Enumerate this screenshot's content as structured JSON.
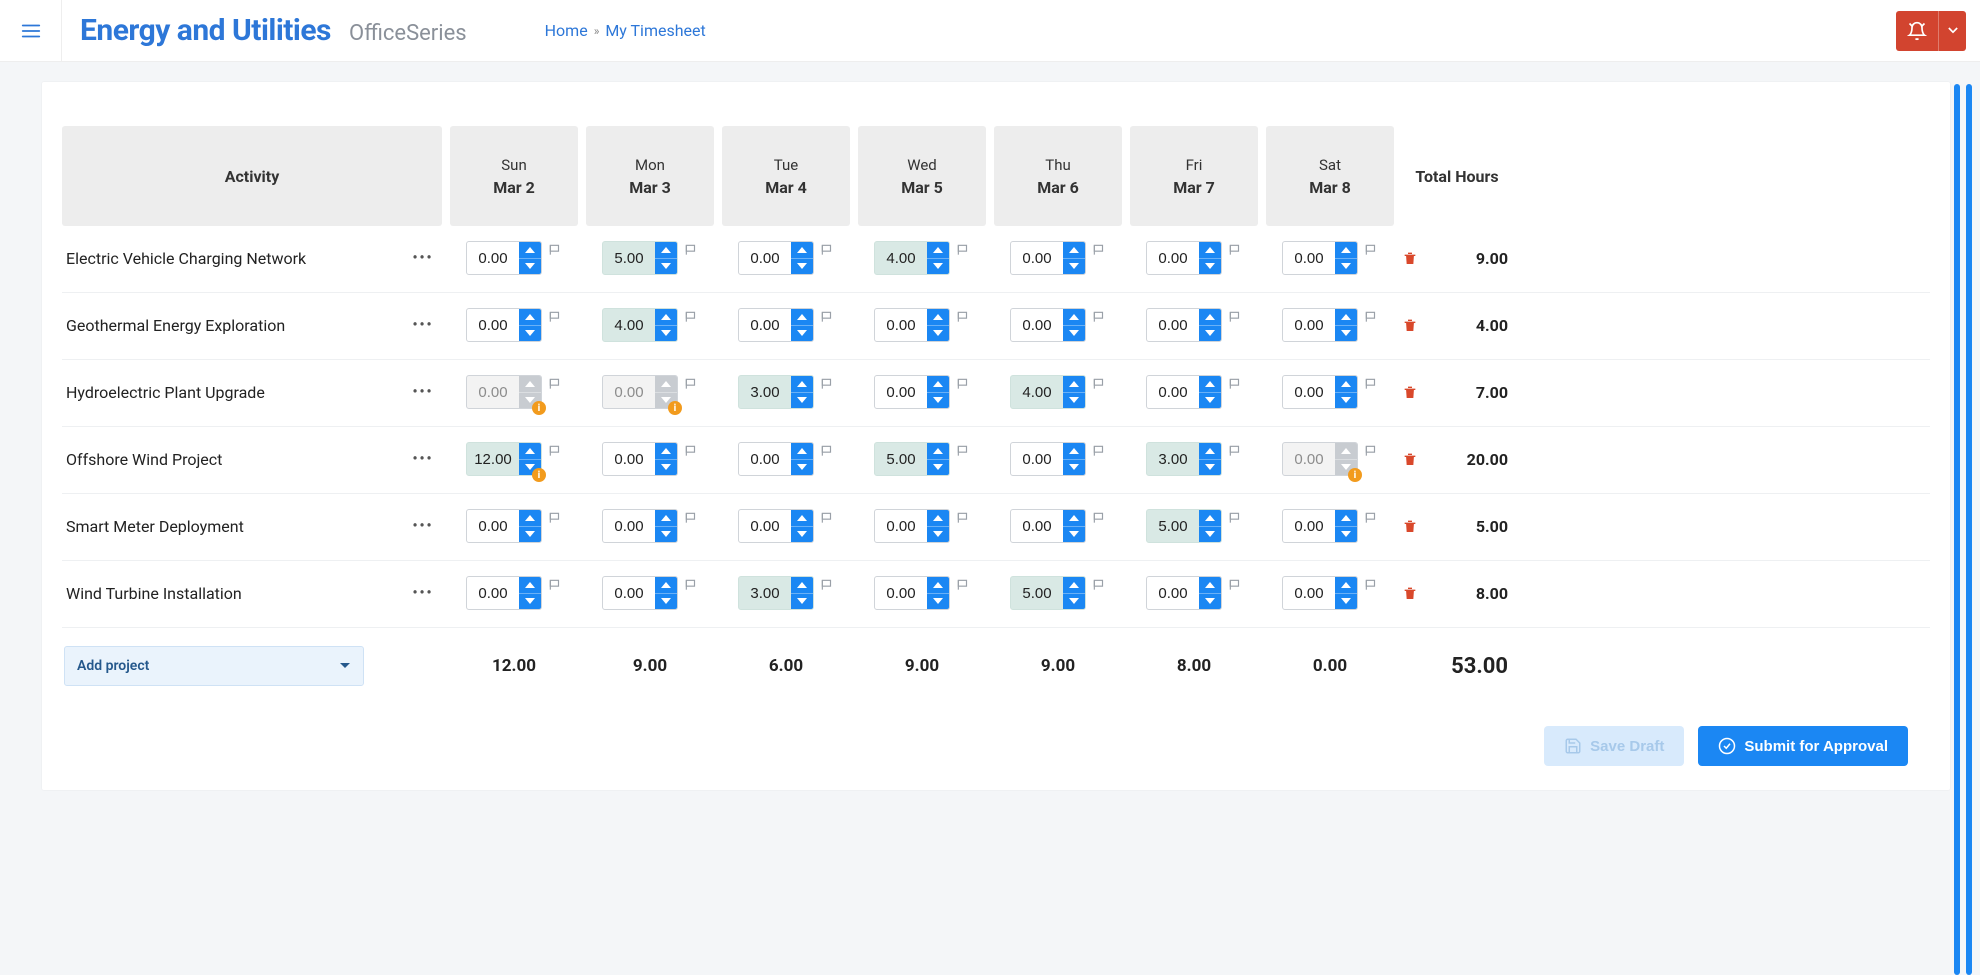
{
  "header": {
    "brand_title": "Energy and Utilities",
    "brand_sub": "OfficeSeries",
    "crumb_home": "Home",
    "crumb_page": "My Timesheet"
  },
  "columns": {
    "activity": "Activity",
    "total": "Total Hours",
    "days": [
      {
        "dow": "Sun",
        "date": "Mar 2"
      },
      {
        "dow": "Mon",
        "date": "Mar 3"
      },
      {
        "dow": "Tue",
        "date": "Mar 4"
      },
      {
        "dow": "Wed",
        "date": "Mar 5"
      },
      {
        "dow": "Thu",
        "date": "Mar 6"
      },
      {
        "dow": "Fri",
        "date": "Mar 7"
      },
      {
        "dow": "Sat",
        "date": "Mar 8"
      }
    ]
  },
  "rows": [
    {
      "name": "Electric Vehicle Charging Network",
      "cells": [
        {
          "v": "0.00"
        },
        {
          "v": "5.00",
          "hi": true
        },
        {
          "v": "0.00"
        },
        {
          "v": "4.00",
          "hi": true
        },
        {
          "v": "0.00"
        },
        {
          "v": "0.00"
        },
        {
          "v": "0.00"
        }
      ],
      "total": "9.00"
    },
    {
      "name": "Geothermal Energy Exploration",
      "cells": [
        {
          "v": "0.00"
        },
        {
          "v": "4.00",
          "hi": true
        },
        {
          "v": "0.00"
        },
        {
          "v": "0.00"
        },
        {
          "v": "0.00"
        },
        {
          "v": "0.00"
        },
        {
          "v": "0.00"
        }
      ],
      "total": "4.00"
    },
    {
      "name": "Hydroelectric Plant Upgrade",
      "cells": [
        {
          "v": "0.00",
          "dis": true,
          "warn": true
        },
        {
          "v": "0.00",
          "dis": true,
          "warn": true
        },
        {
          "v": "3.00",
          "hi": true
        },
        {
          "v": "0.00"
        },
        {
          "v": "4.00",
          "hi": true
        },
        {
          "v": "0.00"
        },
        {
          "v": "0.00"
        }
      ],
      "total": "7.00"
    },
    {
      "name": "Offshore Wind Project",
      "cells": [
        {
          "v": "12.00",
          "hi": true,
          "warn": true
        },
        {
          "v": "0.00"
        },
        {
          "v": "0.00"
        },
        {
          "v": "5.00",
          "hi": true
        },
        {
          "v": "0.00"
        },
        {
          "v": "3.00",
          "hi": true
        },
        {
          "v": "0.00",
          "dis": true,
          "warn": true
        }
      ],
      "total": "20.00"
    },
    {
      "name": "Smart Meter Deployment",
      "cells": [
        {
          "v": "0.00"
        },
        {
          "v": "0.00"
        },
        {
          "v": "0.00"
        },
        {
          "v": "0.00"
        },
        {
          "v": "0.00"
        },
        {
          "v": "5.00",
          "hi": true
        },
        {
          "v": "0.00"
        }
      ],
      "total": "5.00"
    },
    {
      "name": "Wind Turbine Installation",
      "cells": [
        {
          "v": "0.00"
        },
        {
          "v": "0.00"
        },
        {
          "v": "3.00",
          "hi": true
        },
        {
          "v": "0.00"
        },
        {
          "v": "5.00",
          "hi": true
        },
        {
          "v": "0.00"
        },
        {
          "v": "0.00"
        }
      ],
      "total": "8.00"
    }
  ],
  "footer": {
    "add_project": "Add project",
    "day_totals": [
      "12.00",
      "9.00",
      "6.00",
      "9.00",
      "9.00",
      "8.00",
      "0.00"
    ],
    "grand_total": "53.00"
  },
  "buttons": {
    "save_draft": "Save Draft",
    "submit": "Submit for Approval"
  }
}
